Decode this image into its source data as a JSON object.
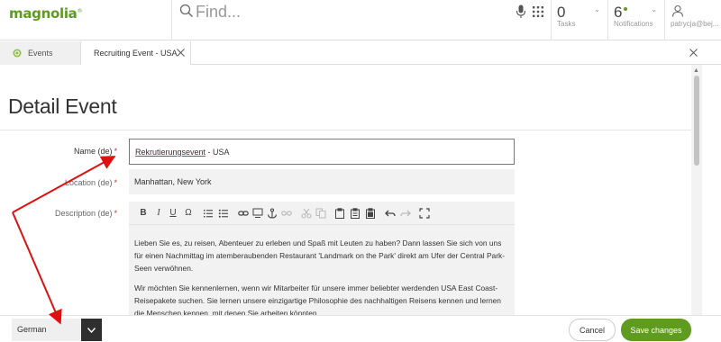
{
  "header": {
    "logo": "magnolia",
    "logo_mark": "®",
    "search_placeholder": "Find...",
    "tasks": {
      "count": "0",
      "label": "Tasks"
    },
    "notifications": {
      "count": "6",
      "label": "Notifications"
    },
    "user": {
      "name": "patrycja@bej..."
    },
    "icons": [
      "search-icon",
      "microphone-icon",
      "app-grid-icon",
      "user-icon",
      "chevron-down-icon"
    ]
  },
  "tabs": [
    {
      "label": "Events",
      "active": false
    },
    {
      "label": "Recruiting Event - USA",
      "active": true
    }
  ],
  "main": {
    "title": "Detail Event",
    "fields": {
      "name": {
        "label": "Name (de)",
        "required": "*",
        "value_word": "Rekrutierungsevent",
        "value_rest": " - USA"
      },
      "location": {
        "label": "Location (de)",
        "required": "*",
        "value": "Manhattan, New York"
      },
      "description": {
        "label": "Description (de)",
        "required": "*",
        "paragraphs": [
          "Lieben Sie es, zu reisen, Abenteuer zu erleben und Spaß mit Leuten zu haben? Dann lassen Sie sich von uns für einen Nachmittag im atemberaubenden Restaurant  'Landmark on the Park' direkt am Ufer der Central Park-Seen verwöhnen.",
          "Wir möchten Sie kennenlernen, wenn wir Mitarbeiter für unsere immer beliebter werdenden USA East Coast-Reisepakete suchen. Sie lernen unsere einzigartige Philosophie des nachhaltigen Reisens kennen und lernen die Menschen kennen, mit denen Sie arbeiten könnten."
        ]
      }
    },
    "toolbar": {
      "bold": "B",
      "italic": "I",
      "underline": "U",
      "special_char": "Ω"
    }
  },
  "footer": {
    "language": "German",
    "cancel_label": "Cancel",
    "save_label": "Save changes"
  },
  "colors": {
    "brand_green": "#5f9b1e",
    "required_red": "#c0392b",
    "annotation_red": "#e01010"
  }
}
